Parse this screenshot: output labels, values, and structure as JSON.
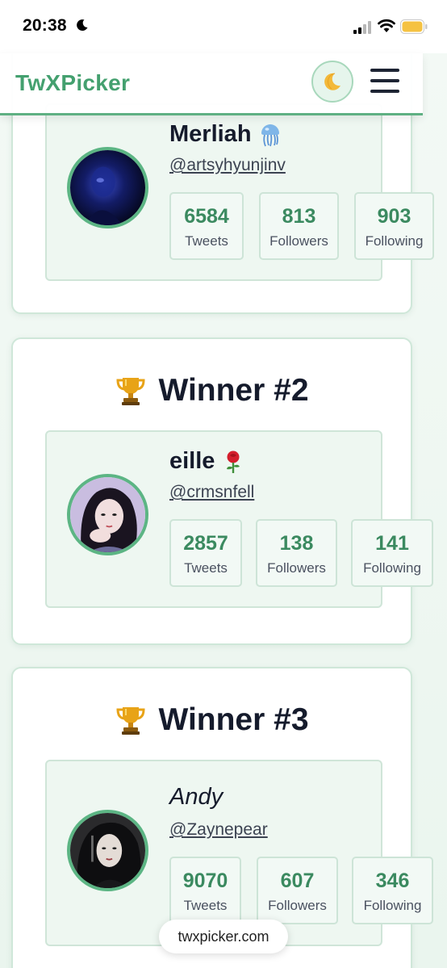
{
  "status_bar": {
    "time": "20:38",
    "icons": [
      "moon-icon",
      "signal-icon",
      "wifi-icon",
      "battery-icon"
    ]
  },
  "navbar": {
    "brand": "TwXPicker",
    "theme_toggle_icon": "moon-icon",
    "menu_icon": "hamburger-icon"
  },
  "cards": [
    {
      "heading": "",
      "name": "Merliah",
      "name_emoji": "jellyfish",
      "handle": "@artsyhyunjinv",
      "stats": [
        {
          "value": "6584",
          "label": "Tweets"
        },
        {
          "value": "813",
          "label": "Followers"
        },
        {
          "value": "903",
          "label": "Following"
        }
      ]
    },
    {
      "heading": "Winner #2",
      "heading_icon": "trophy-icon",
      "name": "eille",
      "name_emoji": "rose",
      "handle": "@crmsnfell",
      "stats": [
        {
          "value": "2857",
          "label": "Tweets"
        },
        {
          "value": "138",
          "label": "Followers"
        },
        {
          "value": "141",
          "label": "Following"
        }
      ]
    },
    {
      "heading": "Winner #3",
      "heading_icon": "trophy-icon",
      "name": "Andy",
      "handle": "@Zaynepear",
      "stats": [
        {
          "value": "9070",
          "label": "Tweets"
        },
        {
          "value": "607",
          "label": "Followers"
        },
        {
          "value": "346",
          "label": "Following"
        }
      ]
    }
  ],
  "footer": {
    "site": "twxpicker.com"
  },
  "colors": {
    "brand": "#44a06f",
    "accent_border": "#5fb083",
    "stat_value": "#3b8a60"
  }
}
